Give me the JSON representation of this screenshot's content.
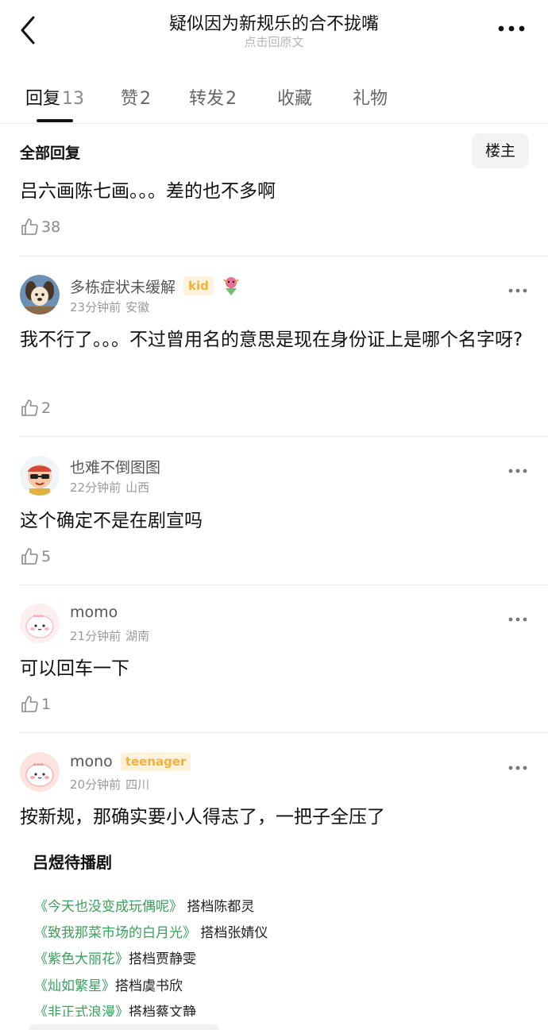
{
  "header": {
    "title": "疑似因为新规乐的合不拢嘴",
    "subtitle": "点击回原文"
  },
  "tabs": [
    {
      "label": "回复",
      "count": "13",
      "active": true
    },
    {
      "label": "赞",
      "count": "2"
    },
    {
      "label": "转发",
      "count": "2"
    },
    {
      "label": "收藏",
      "count": ""
    },
    {
      "label": "礼物",
      "count": ""
    }
  ],
  "section": {
    "title": "全部回复",
    "op_filter": "楼主"
  },
  "first_reply": {
    "text": "吕六画陈七画。。。差的也不多啊",
    "likes": "38"
  },
  "comments": [
    {
      "username": "多栋症状未缓解",
      "badge": "kid",
      "time": "23分钟前",
      "location": "安徽",
      "text": "我不行了。。。不过曾用名的意思是现在身份证上是哪个名字呀?",
      "likes": "2"
    },
    {
      "username": "也难不倒图图",
      "time": "22分钟前",
      "location": "山西",
      "text": "这个确定不是在剧宣吗",
      "likes": "5"
    },
    {
      "username": "momo",
      "time": "21分钟前",
      "location": "湖南",
      "text": "可以回车一下",
      "likes": "1"
    },
    {
      "username": "mono",
      "badge": "teenager",
      "time": "20分钟前",
      "location": "四川",
      "text": "按新规，那确实要小人得志了，一把子全压了"
    }
  ],
  "quote": {
    "title": "吕煜待播剧",
    "items": [
      {
        "drama": "《今天也没变成玩偶呢》",
        "partner": "搭档陈都灵"
      },
      {
        "drama": "《致我那菜市场的白月光》",
        "partner": "搭档张婧仪"
      },
      {
        "drama": "《紫色大丽花》",
        "partner": "搭档贾静雯"
      },
      {
        "drama": "《灿如繁星》",
        "partner": "搭档虞书欣"
      },
      {
        "drama": "《非正式浪漫》",
        "partner": "搭档蔡文静"
      }
    ]
  },
  "colors": {
    "green": "#38a15a",
    "badge_bg": "#fdf3dc",
    "badge_text": "#f0b23b",
    "muted": "#9a9a9a"
  },
  "icons": [
    "back-arrow-icon",
    "more-icon",
    "thumb-up-icon",
    "more-dots-icon"
  ]
}
